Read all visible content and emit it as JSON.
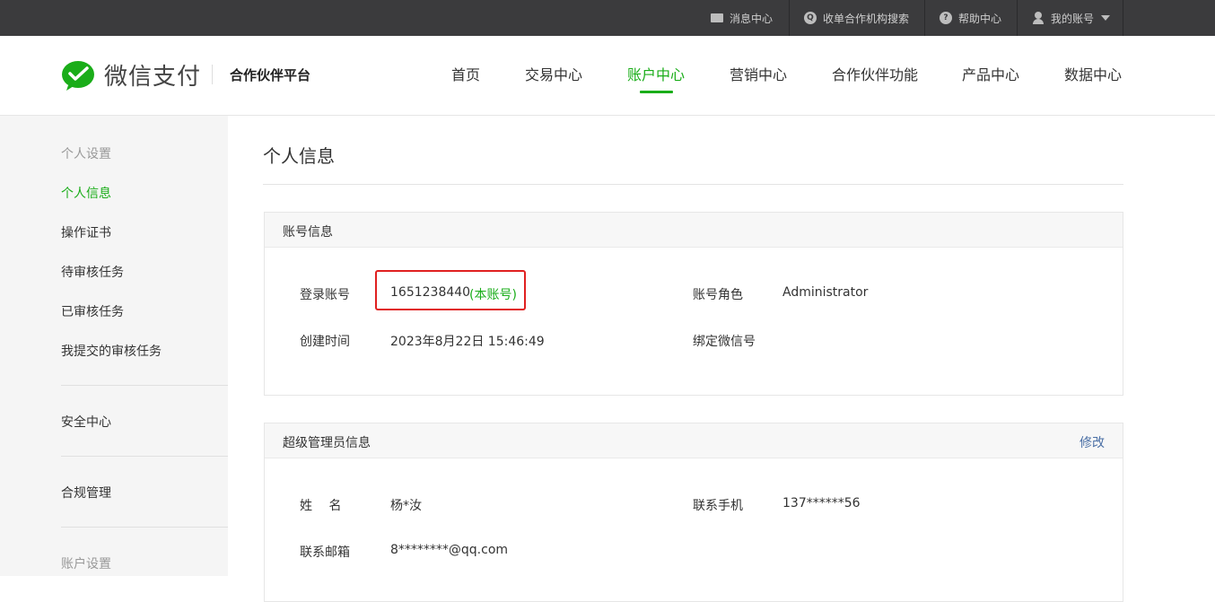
{
  "topbar": {
    "messages": "消息中心",
    "search_org": "收单合作机构搜索",
    "help": "帮助中心",
    "account": "我的账号"
  },
  "header": {
    "logo_text": "微信支付",
    "platform": "合作伙伴平台",
    "nav": [
      "首页",
      "交易中心",
      "账户中心",
      "营销中心",
      "合作伙伴功能",
      "产品中心",
      "数据中心"
    ],
    "active_nav": "账户中心"
  },
  "sidebar": {
    "section_personal": "个人设置",
    "personal_info": "个人信息",
    "cert": "操作证书",
    "pending": "待审核任务",
    "reviewed": "已审核任务",
    "submitted": "我提交的审核任务",
    "security": "安全中心",
    "compliance": "合规管理",
    "section_account": "账户设置"
  },
  "main": {
    "title": "个人信息",
    "account_panel": {
      "title": "账号信息",
      "login_label": "登录账号",
      "login_value": "1651238440",
      "login_tag": "(本账号)",
      "role_label": "账号角色",
      "role_value": "Administrator",
      "created_label": "创建时间",
      "created_value": "2023年8月22日 15:46:49",
      "wechat_label": "绑定微信号",
      "wechat_value": ""
    },
    "admin_panel": {
      "title": "超级管理员信息",
      "edit": "修改",
      "name_label": "姓　 名",
      "name_value": "杨*汝",
      "phone_label": "联系手机",
      "phone_value": "137******56",
      "email_label": "联系邮箱",
      "email_value": "8********@qq.com"
    }
  },
  "colors": {
    "brand_green": "#1aad19",
    "topbar_bg": "#3b3b3d",
    "highlight_red": "#e02020",
    "link_blue": "#4a6fa5"
  }
}
